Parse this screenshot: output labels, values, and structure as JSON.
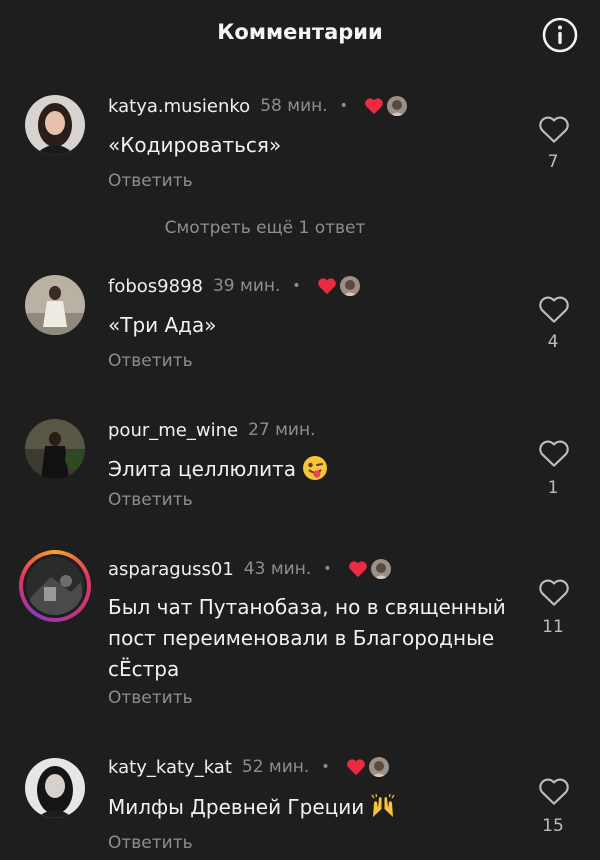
{
  "header": {
    "title": "Комментарии",
    "info_icon": "info-icon"
  },
  "more_replies": "Смотреть ещё 1 ответ",
  "reply_label": "Ответить",
  "comments": [
    {
      "username": "katya.musienko",
      "time": "58 мин.",
      "dot": "•",
      "text": "«Кодироваться»",
      "likes": "7"
    },
    {
      "username": "fobos9898",
      "time": "39 мин.",
      "dot": "•",
      "text": "«Три Ада»",
      "likes": "4"
    },
    {
      "username": "pour_me_wine",
      "time": "27 мин.",
      "text": "Элита целлюлита",
      "likes": "1"
    },
    {
      "username": "asparaguss01",
      "time": "43 мин.",
      "dot": "•",
      "text": "Был чат Путанобаза, но в священный пост переименовали в Благородные сЁстра",
      "likes": "11"
    },
    {
      "username": "katy_katy_kat",
      "time": "52 мин.",
      "dot": "•",
      "text": "Милфы Древней Греции",
      "likes": "15"
    }
  ],
  "colors": {
    "background": "#1e1e1f",
    "heart": "#ed2b40",
    "muted": "#8e8e8e",
    "text": "#f2f2f2"
  }
}
